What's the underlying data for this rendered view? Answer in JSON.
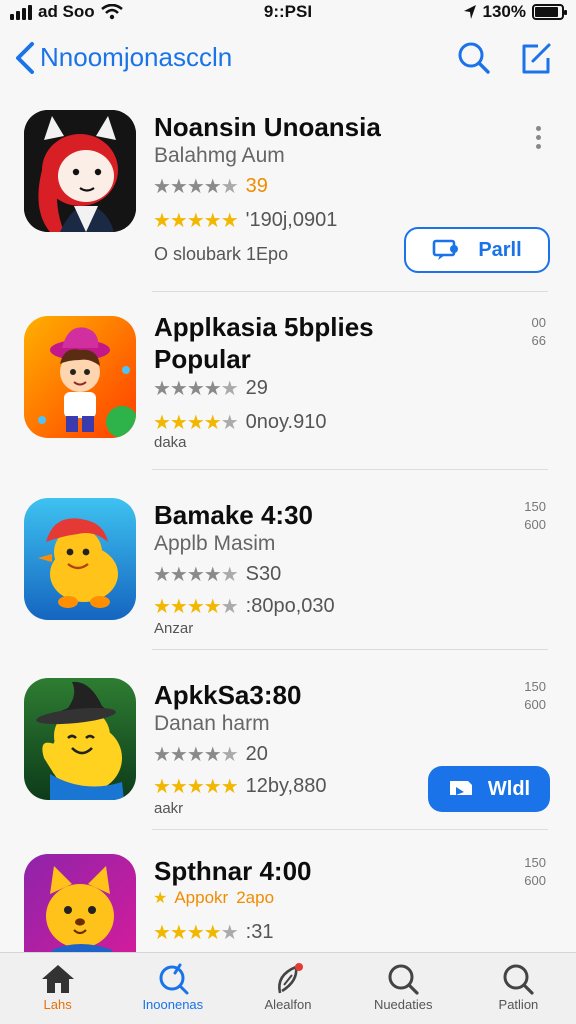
{
  "status_bar": {
    "carrier": "ad Soo",
    "time": "9::PSI",
    "battery": "130%"
  },
  "nav": {
    "title": "Nnoomjonasccln"
  },
  "apps": [
    {
      "title": "Noansin Unoansia",
      "subtitle": "Balahmg Aum",
      "rating_a": "39",
      "rating_b": "'190j,0901",
      "meta": "O sloubark   1Epo",
      "button": "Parll",
      "stars_a": 4,
      "stars_b": 5
    },
    {
      "title": "Applkasia 5bplies",
      "title2": "Popular",
      "rating_a": "29",
      "rating_b": "0noy.910",
      "meta": "daka",
      "side_top": "00",
      "side_bottom": "66",
      "stars_a": 4,
      "stars_b": 4
    },
    {
      "title": "Bamake 4:30",
      "subtitle": "Applb Masim",
      "rating_a": "S30",
      "rating_b": ":80po,030",
      "meta": "Anzar",
      "side_top": "150",
      "side_bottom": "600",
      "stars_a": 4,
      "stars_b": 4
    },
    {
      "title": "ApkkSa3:80",
      "subtitle": "Danan harm",
      "rating_a": "20",
      "rating_b": "12by,880",
      "meta": "aakr",
      "side_top": "150",
      "side_bottom": "600",
      "button": "Wldl",
      "stars_a": 4,
      "stars_b": 5
    },
    {
      "title": "Spthnar 4:00",
      "rating_a": "2apo",
      "accent_label": "Appokr",
      "rating_b": ":31",
      "side_top": "150",
      "side_bottom": "600",
      "stars_b": 4
    }
  ],
  "tabs": [
    {
      "label": "Lahs"
    },
    {
      "label": "Inoonenas"
    },
    {
      "label": "Alealfon"
    },
    {
      "label": "Nuedaties"
    },
    {
      "label": "Patlion"
    }
  ],
  "colors": {
    "accent": "#1a73e8",
    "star": "#f2b700",
    "orange": "#e8710a"
  }
}
